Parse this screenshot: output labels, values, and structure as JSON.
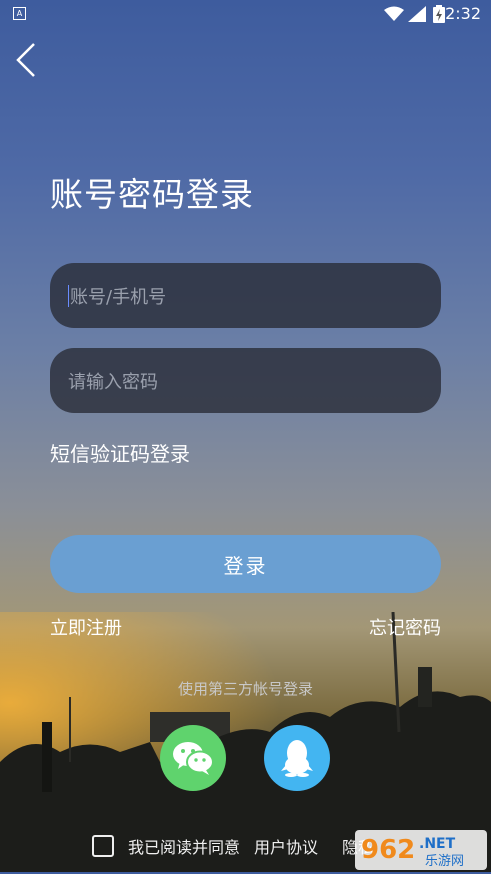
{
  "status_bar": {
    "time": "2:32",
    "notification_icon": "A"
  },
  "header": {
    "title": "账号密码登录"
  },
  "form": {
    "account_placeholder": "账号/手机号",
    "password_placeholder": "请输入密码",
    "sms_login": "短信验证码登录",
    "login_button": "登录",
    "register": "立即注册",
    "forgot_password": "忘记密码"
  },
  "third_party": {
    "label": "使用第三方帐号登录",
    "options": [
      "wechat-icon",
      "qq-icon"
    ]
  },
  "agreement": {
    "text": "我已阅读并同意",
    "user_agreement": "用户协议",
    "privacy_partial": "隐私"
  },
  "watermark": {
    "number": "962",
    "domain": ".NET",
    "subtitle": "乐游网"
  },
  "colors": {
    "login_button": "#6a9fd2",
    "wechat": "#5fd36d",
    "qq": "#43b5f1",
    "field_bg": "#2a2c34"
  }
}
